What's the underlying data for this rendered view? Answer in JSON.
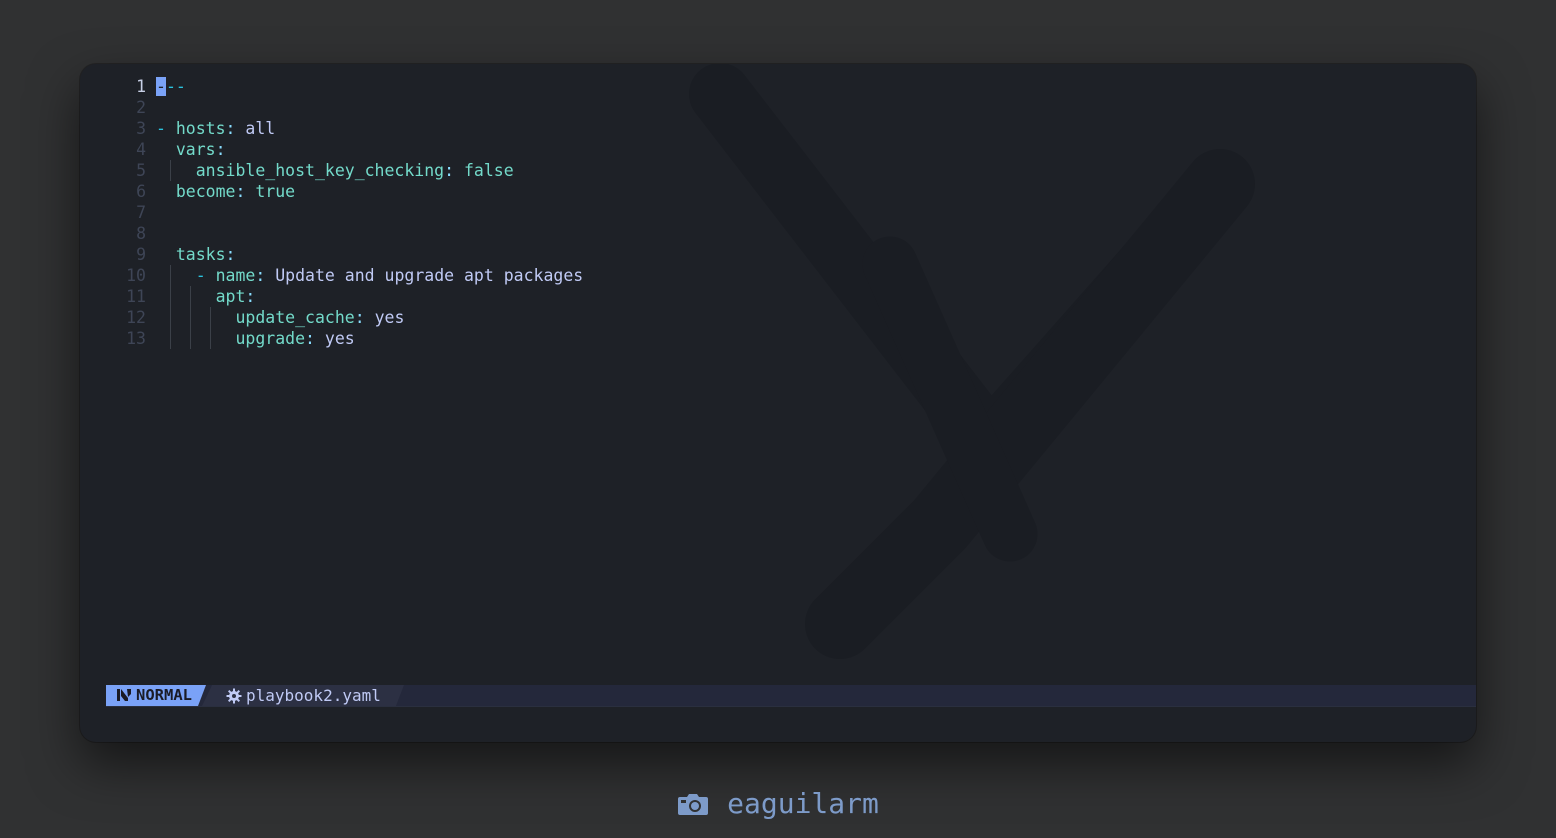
{
  "editor": {
    "lines": [
      {
        "num": "1",
        "segments": [
          {
            "t": "-",
            "c": "cursor"
          },
          {
            "t": "--",
            "c": "dash"
          }
        ]
      },
      {
        "num": "2",
        "segments": []
      },
      {
        "num": "3",
        "segments": [
          {
            "t": "- ",
            "c": "dash"
          },
          {
            "t": "hosts",
            "c": "key"
          },
          {
            "t": ": ",
            "c": "punct"
          },
          {
            "t": "all",
            "c": "val"
          }
        ]
      },
      {
        "num": "4",
        "segments": [
          {
            "t": "  ",
            "c": ""
          },
          {
            "t": "vars",
            "c": "key"
          },
          {
            "t": ":",
            "c": "punct"
          }
        ]
      },
      {
        "num": "5",
        "segments": [
          {
            "t": "    ",
            "c": ""
          },
          {
            "t": "ansible_host_key_checking",
            "c": "key"
          },
          {
            "t": ": ",
            "c": "punct"
          },
          {
            "t": "false",
            "c": "kw"
          }
        ]
      },
      {
        "num": "6",
        "segments": [
          {
            "t": "  ",
            "c": ""
          },
          {
            "t": "become",
            "c": "key"
          },
          {
            "t": ": ",
            "c": "punct"
          },
          {
            "t": "true",
            "c": "kw"
          }
        ]
      },
      {
        "num": "7",
        "segments": []
      },
      {
        "num": "8",
        "segments": []
      },
      {
        "num": "9",
        "segments": [
          {
            "t": "  ",
            "c": ""
          },
          {
            "t": "tasks",
            "c": "key"
          },
          {
            "t": ":",
            "c": "punct"
          }
        ]
      },
      {
        "num": "10",
        "segments": [
          {
            "t": "    ",
            "c": ""
          },
          {
            "t": "- ",
            "c": "dash"
          },
          {
            "t": "name",
            "c": "key"
          },
          {
            "t": ": ",
            "c": "punct"
          },
          {
            "t": "Update and upgrade apt packages",
            "c": "val"
          }
        ]
      },
      {
        "num": "11",
        "segments": [
          {
            "t": "      ",
            "c": ""
          },
          {
            "t": "apt",
            "c": "key"
          },
          {
            "t": ":",
            "c": "punct"
          }
        ]
      },
      {
        "num": "12",
        "segments": [
          {
            "t": "        ",
            "c": ""
          },
          {
            "t": "update_cache",
            "c": "key"
          },
          {
            "t": ": ",
            "c": "punct"
          },
          {
            "t": "yes",
            "c": "val"
          }
        ]
      },
      {
        "num": "13",
        "segments": [
          {
            "t": "        ",
            "c": ""
          },
          {
            "t": "upgrade",
            "c": "key"
          },
          {
            "t": ": ",
            "c": "punct"
          },
          {
            "t": "yes",
            "c": "val"
          }
        ]
      }
    ],
    "current_line": "1"
  },
  "statusbar": {
    "mode": "NORMAL",
    "mode_icon": "neovim-icon",
    "file_icon": "gear-icon",
    "filename": "playbook2.yaml"
  },
  "credit": {
    "icon": "camera-icon",
    "username": "eaguilarm"
  },
  "colors": {
    "background": "#303132",
    "editor_bg": "#1e2127",
    "mode_bg": "#7aa2f7",
    "key": "#73daca",
    "text": "#c0caf5",
    "credit": "#7d9bc9"
  }
}
